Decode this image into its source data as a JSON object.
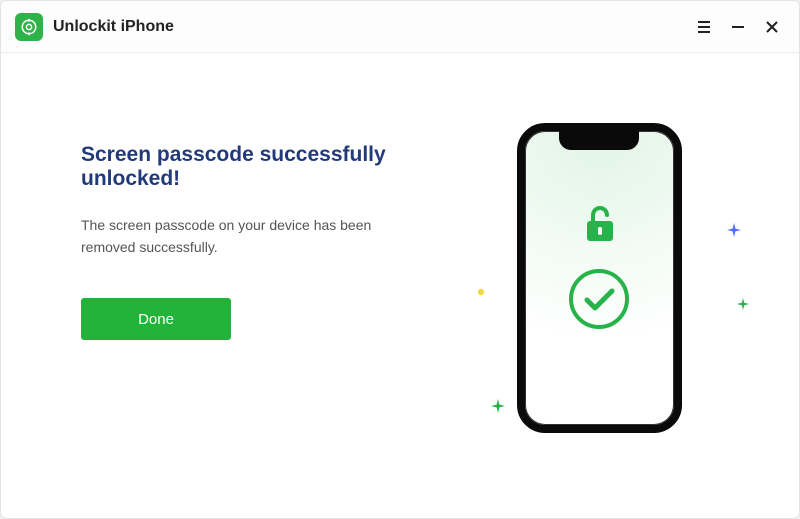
{
  "app": {
    "title": "Unlockit iPhone"
  },
  "main": {
    "headline": "Screen passcode successfully unlocked!",
    "description": "The screen passcode on your device has been removed successfully.",
    "done_label": "Done"
  },
  "colors": {
    "brand_green": "#23b23a",
    "heading_navy": "#223a7a"
  },
  "icons": {
    "logo": "location-lock-icon",
    "unlock": "unlock-icon",
    "check": "check-circle-icon"
  }
}
